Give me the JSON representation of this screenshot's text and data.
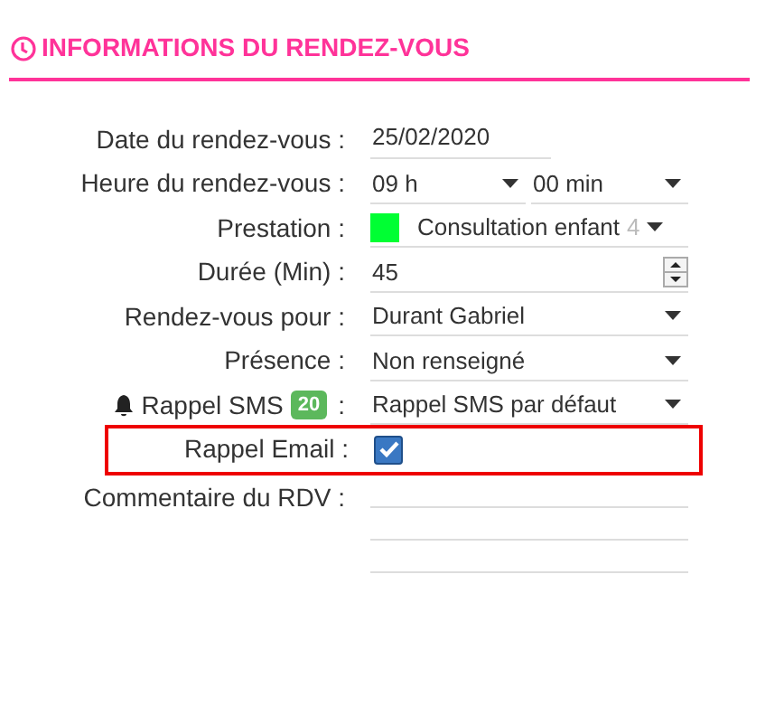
{
  "section": {
    "title": "INFORMATIONS DU RENDEZ-VOUS"
  },
  "rows": [
    {
      "kind": "text",
      "label": "Date du rendez-vous :",
      "value": "25/02/2020"
    },
    {
      "kind": "double-select",
      "label": "Heure du rendez-vous :",
      "value": "09 h",
      "value_2": "00 min"
    },
    {
      "kind": "color-select",
      "label": "Prestation :",
      "color": "#00ff33",
      "value": "Consultation enfant",
      "value_cut": "4"
    },
    {
      "kind": "number",
      "label": "Durée (Min) :",
      "value": "45"
    },
    {
      "kind": "select",
      "label": "Rendez-vous pour :",
      "value": "Durant Gabriel"
    },
    {
      "kind": "select",
      "label": "Présence :",
      "value": "Non renseigné"
    },
    {
      "kind": "select",
      "label": "Rappel SMS",
      "badge": "20",
      "colon": ":",
      "value": "Rappel SMS par défaut"
    },
    {
      "kind": "checkbox",
      "label": "Rappel Email :",
      "checked": true,
      "highlighted": true
    },
    {
      "kind": "textarea",
      "label": "Commentaire du RDV :"
    }
  ]
}
